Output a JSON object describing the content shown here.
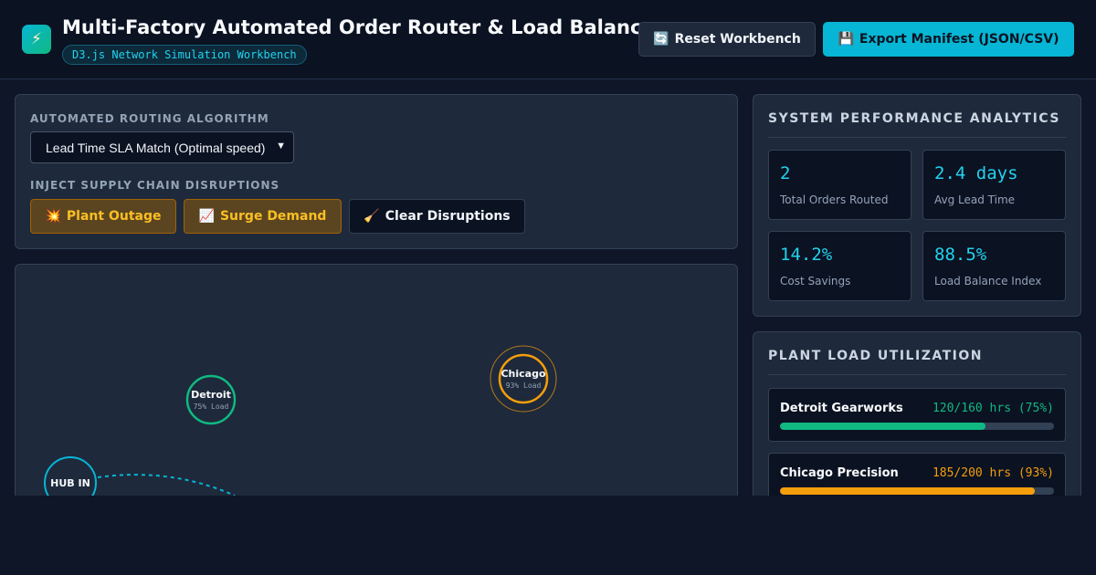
{
  "header": {
    "logo_icon": "lightning-bolt-icon",
    "logo_glyph": "⚡",
    "title": "Multi-Factory Automated Order Router & Load Balancer",
    "subtitle": "D3.js Network Simulation Workbench",
    "reset_icon": "🔄",
    "reset_label": "Reset Workbench",
    "export_icon": "💾",
    "export_label": "Export Manifest (JSON/CSV)"
  },
  "controls": {
    "algorithm_label": "AUTOMATED ROUTING ALGORITHM",
    "algorithm_selected": "Lead Time SLA Match (Optimal speed)",
    "disruptions_label": "INJECT SUPPLY CHAIN DISRUPTIONS",
    "outage_icon": "💥",
    "outage_label": "Plant Outage",
    "surge_icon": "📈",
    "surge_label": "Surge Demand",
    "clear_icon": "🧹",
    "clear_label": "Clear Disruptions"
  },
  "network": {
    "nodes": [
      {
        "id": "detroit",
        "label": "Detroit",
        "sub": "75% Load",
        "color": "#10b981"
      },
      {
        "id": "chicago",
        "label": "Chicago",
        "sub": "93% Load",
        "color": "#f59e0b"
      },
      {
        "id": "hub",
        "label": "HUB IN",
        "sub": "",
        "color": "#06b6d4"
      }
    ]
  },
  "analytics": {
    "title": "SYSTEM PERFORMANCE ANALYTICS",
    "metrics": [
      {
        "value": "2",
        "label": "Total Orders Routed"
      },
      {
        "value": "2.4 days",
        "label": "Avg Lead Time"
      },
      {
        "value": "14.2%",
        "label": "Cost Savings"
      },
      {
        "value": "88.5%",
        "label": "Load Balance Index"
      }
    ]
  },
  "utilization": {
    "title": "PLANT LOAD UTILIZATION",
    "plants": [
      {
        "name": "Detroit Gearworks",
        "hours": "120/160 hrs (75%)",
        "fraction": 0.75,
        "color": "#10b981"
      },
      {
        "name": "Chicago Precision",
        "hours": "185/200 hrs (93%)",
        "fraction": 0.93,
        "color": "#f59e0b"
      }
    ]
  }
}
